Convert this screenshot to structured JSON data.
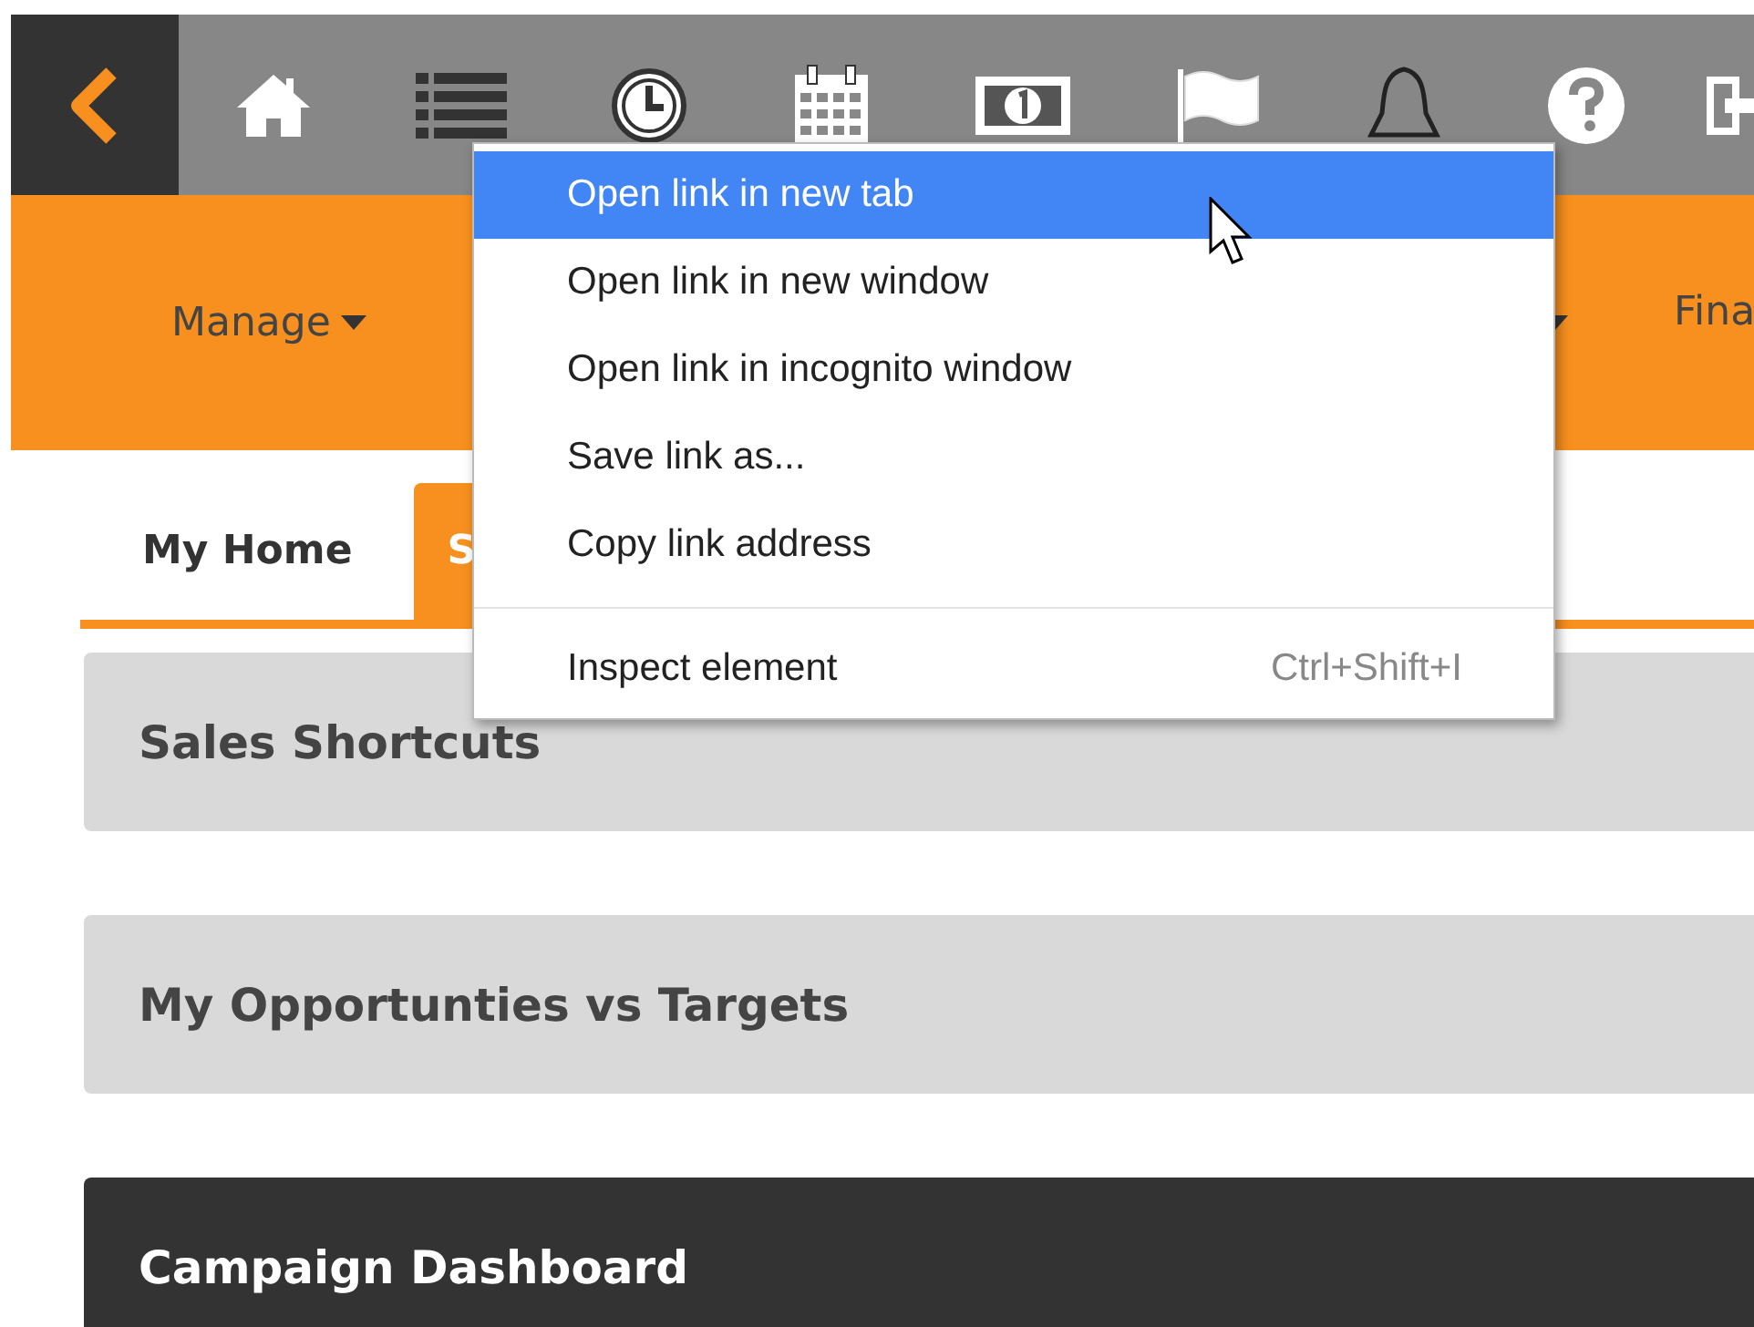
{
  "nav_items": [
    {
      "kind": "dropdown",
      "label": "Manage"
    },
    {
      "kind": "caret"
    },
    {
      "kind": "link",
      "label": "Fina"
    }
  ],
  "tabs": [
    {
      "label": "My Home",
      "selected": false
    },
    {
      "label": "S",
      "selected": true
    }
  ],
  "panels": [
    {
      "title": "Sales Shortcuts",
      "kind": "light"
    },
    {
      "title": "My Opportunties vs Targets",
      "kind": "light"
    },
    {
      "title": "Campaign Dashboard",
      "kind": "dark"
    }
  ],
  "context_menu": {
    "items": [
      {
        "label": "Open link in new tab",
        "selected": true,
        "separator_before": false
      },
      {
        "label": "Open link in new window",
        "selected": false,
        "separator_before": false
      },
      {
        "label": "Open link in incognito window",
        "selected": false,
        "separator_before": false
      },
      {
        "label": "Save link as...",
        "selected": false,
        "separator_before": false
      },
      {
        "label": "Copy link address",
        "selected": false,
        "separator_before": false
      },
      {
        "label": "Inspect element",
        "shortcut": "Ctrl+Shift+I",
        "selected": false,
        "separator_before": true
      }
    ]
  }
}
